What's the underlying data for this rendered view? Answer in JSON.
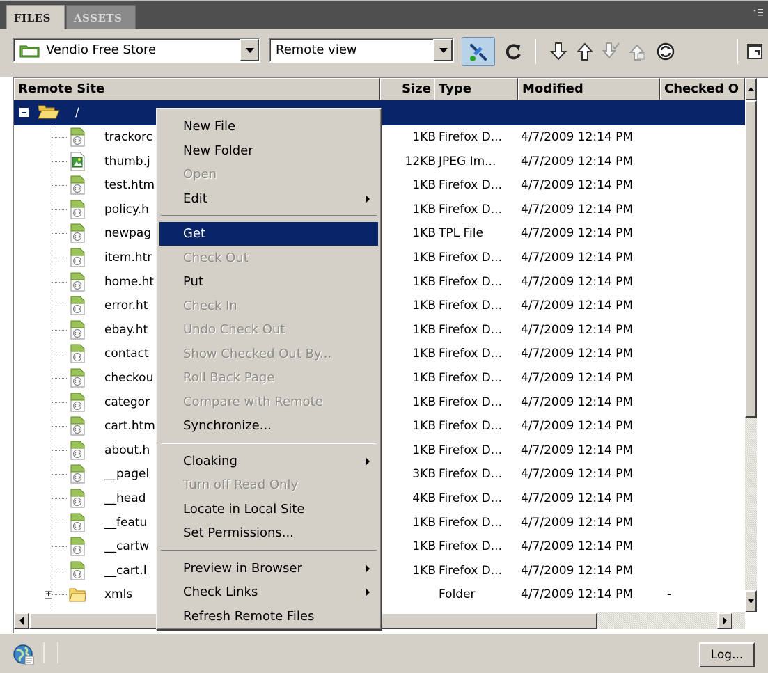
{
  "tabs": {
    "files": "FILES",
    "assets": "ASSETS"
  },
  "toolbar": {
    "site_select": "Vendio Free Store",
    "view_select": "Remote view",
    "icons": [
      "connect-icon",
      "refresh-icon",
      "get-icon",
      "put-icon",
      "check-out-icon",
      "check-in-icon",
      "synchronize-icon",
      "expand-icon"
    ]
  },
  "columns": {
    "name": "Remote Site",
    "size": "Size",
    "type": "Type",
    "modified": "Modified",
    "checked_out": "Checked O"
  },
  "root": {
    "name": "/"
  },
  "files": [
    {
      "name": "trackorc",
      "size": "1KB",
      "type": "Firefox D...",
      "modified": "4/7/2009 12:14 PM",
      "icon": "html-file-icon"
    },
    {
      "name": "thumb.j",
      "size": "12KB",
      "type": "JPEG Im...",
      "modified": "4/7/2009 12:14 PM",
      "icon": "image-file-icon"
    },
    {
      "name": "test.htm",
      "size": "1KB",
      "type": "Firefox D...",
      "modified": "4/7/2009 12:14 PM",
      "icon": "html-file-icon"
    },
    {
      "name": "policy.h",
      "size": "1KB",
      "type": "Firefox D...",
      "modified": "4/7/2009 12:14 PM",
      "icon": "html-file-icon"
    },
    {
      "name": "newpag",
      "size": "1KB",
      "type": "TPL File",
      "modified": "4/7/2009 12:14 PM",
      "icon": "html-file-icon"
    },
    {
      "name": "item.htr",
      "size": "1KB",
      "type": "Firefox D...",
      "modified": "4/7/2009 12:14 PM",
      "icon": "html-file-icon"
    },
    {
      "name": "home.ht",
      "size": "1KB",
      "type": "Firefox D...",
      "modified": "4/7/2009 12:14 PM",
      "icon": "html-file-icon"
    },
    {
      "name": "error.ht",
      "size": "1KB",
      "type": "Firefox D...",
      "modified": "4/7/2009 12:14 PM",
      "icon": "html-file-icon"
    },
    {
      "name": "ebay.ht",
      "size": "1KB",
      "type": "Firefox D...",
      "modified": "4/7/2009 12:14 PM",
      "icon": "html-file-icon"
    },
    {
      "name": "contact",
      "size": "1KB",
      "type": "Firefox D...",
      "modified": "4/7/2009 12:14 PM",
      "icon": "html-file-icon"
    },
    {
      "name": "checkou",
      "size": "1KB",
      "type": "Firefox D...",
      "modified": "4/7/2009 12:14 PM",
      "icon": "html-file-icon"
    },
    {
      "name": "categor",
      "size": "1KB",
      "type": "Firefox D...",
      "modified": "4/7/2009 12:14 PM",
      "icon": "html-file-icon"
    },
    {
      "name": "cart.htm",
      "size": "1KB",
      "type": "Firefox D...",
      "modified": "4/7/2009 12:14 PM",
      "icon": "html-file-icon"
    },
    {
      "name": "about.h",
      "size": "1KB",
      "type": "Firefox D...",
      "modified": "4/7/2009 12:14 PM",
      "icon": "html-file-icon"
    },
    {
      "name": "__pagel",
      "size": "3KB",
      "type": "Firefox D...",
      "modified": "4/7/2009 12:14 PM",
      "icon": "html-file-icon"
    },
    {
      "name": "__head",
      "size": "4KB",
      "type": "Firefox D...",
      "modified": "4/7/2009 12:14 PM",
      "icon": "html-file-icon"
    },
    {
      "name": "__featu",
      "size": "1KB",
      "type": "Firefox D...",
      "modified": "4/7/2009 12:14 PM",
      "icon": "html-file-icon"
    },
    {
      "name": "__cartw",
      "size": "1KB",
      "type": "Firefox D...",
      "modified": "4/7/2009 12:14 PM",
      "icon": "html-file-icon"
    },
    {
      "name": "__cart.l",
      "size": "1KB",
      "type": "Firefox D...",
      "modified": "4/7/2009 12:14 PM",
      "icon": "html-file-icon"
    },
    {
      "name": "xmls",
      "size": "",
      "type": "Folder",
      "modified": "4/7/2009 12:14 PM",
      "checked": "-",
      "icon": "folder-icon"
    }
  ],
  "context_menu": [
    {
      "label": "New File",
      "enabled": true
    },
    {
      "label": "New Folder",
      "enabled": true
    },
    {
      "label": "Open",
      "enabled": false
    },
    {
      "label": "Edit",
      "enabled": true,
      "submenu": true
    },
    {
      "separator": true
    },
    {
      "label": "Get",
      "enabled": true,
      "selected": true
    },
    {
      "label": "Check Out",
      "enabled": false
    },
    {
      "label": "Put",
      "enabled": true
    },
    {
      "label": "Check In",
      "enabled": false
    },
    {
      "label": "Undo Check Out",
      "enabled": false
    },
    {
      "label": "Show Checked Out By...",
      "enabled": false
    },
    {
      "label": "Roll Back Page",
      "enabled": false
    },
    {
      "label": "Compare with Remote",
      "enabled": false
    },
    {
      "label": "Synchronize...",
      "enabled": true
    },
    {
      "separator": true
    },
    {
      "label": "Cloaking",
      "enabled": true,
      "submenu": true
    },
    {
      "label": "Turn off Read Only",
      "enabled": false
    },
    {
      "label": "Locate in Local Site",
      "enabled": true
    },
    {
      "label": "Set Permissions...",
      "enabled": true
    },
    {
      "separator": true
    },
    {
      "label": "Preview in Browser",
      "enabled": true,
      "submenu": true
    },
    {
      "label": "Check Links",
      "enabled": true,
      "submenu": true
    },
    {
      "label": "Refresh Remote Files",
      "enabled": true
    }
  ],
  "status": {
    "log_button": "Log..."
  },
  "colors": {
    "selection": "#0a246a",
    "panel": "#d4d0c8",
    "tab_bar": "#4f4f4f"
  }
}
